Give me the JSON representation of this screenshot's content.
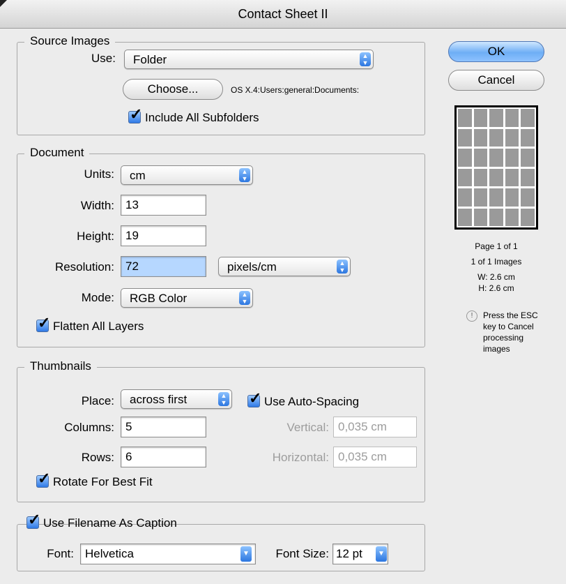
{
  "window": {
    "title": "Contact Sheet II"
  },
  "source_images": {
    "title": "Source Images",
    "use_label": "Use:",
    "use_value": "Folder",
    "choose_label": "Choose...",
    "path": "OS X.4:Users:general:Documents:",
    "include_subfolders_label": "Include All Subfolders",
    "include_subfolders_checked": true
  },
  "document": {
    "title": "Document",
    "units_label": "Units:",
    "units_value": "cm",
    "width_label": "Width:",
    "width_value": "13",
    "height_label": "Height:",
    "height_value": "19",
    "resolution_label": "Resolution:",
    "resolution_value": "72",
    "resolution_unit": "pixels/cm",
    "mode_label": "Mode:",
    "mode_value": "RGB Color",
    "flatten_label": "Flatten All Layers",
    "flatten_checked": true
  },
  "thumbnails": {
    "title": "Thumbnails",
    "place_label": "Place:",
    "place_value": "across first",
    "auto_spacing_label": "Use Auto-Spacing",
    "auto_spacing_checked": true,
    "columns_label": "Columns:",
    "columns_value": "5",
    "rows_label": "Rows:",
    "rows_value": "6",
    "vertical_label": "Vertical:",
    "vertical_value": "0,035 cm",
    "horizontal_label": "Horizontal:",
    "horizontal_value": "0,035 cm",
    "rotate_label": "Rotate For Best Fit",
    "rotate_checked": true
  },
  "caption": {
    "use_filename_label": "Use Filename As Caption",
    "use_filename_checked": true,
    "font_label": "Font:",
    "font_value": "Helvetica",
    "font_size_label": "Font Size:",
    "font_size_value": "12 pt"
  },
  "buttons": {
    "ok": "OK",
    "cancel": "Cancel"
  },
  "preview_info": {
    "page": "Page 1 of 1",
    "images": "1 of 1 Images",
    "w": "W: 2.6 cm",
    "h": "H: 2.6 cm",
    "note_icon": "!",
    "note": "Press the ESC key to Cancel processing images"
  },
  "colors": {
    "accent": "#3b82e6",
    "selection": "#b6d7ff"
  }
}
